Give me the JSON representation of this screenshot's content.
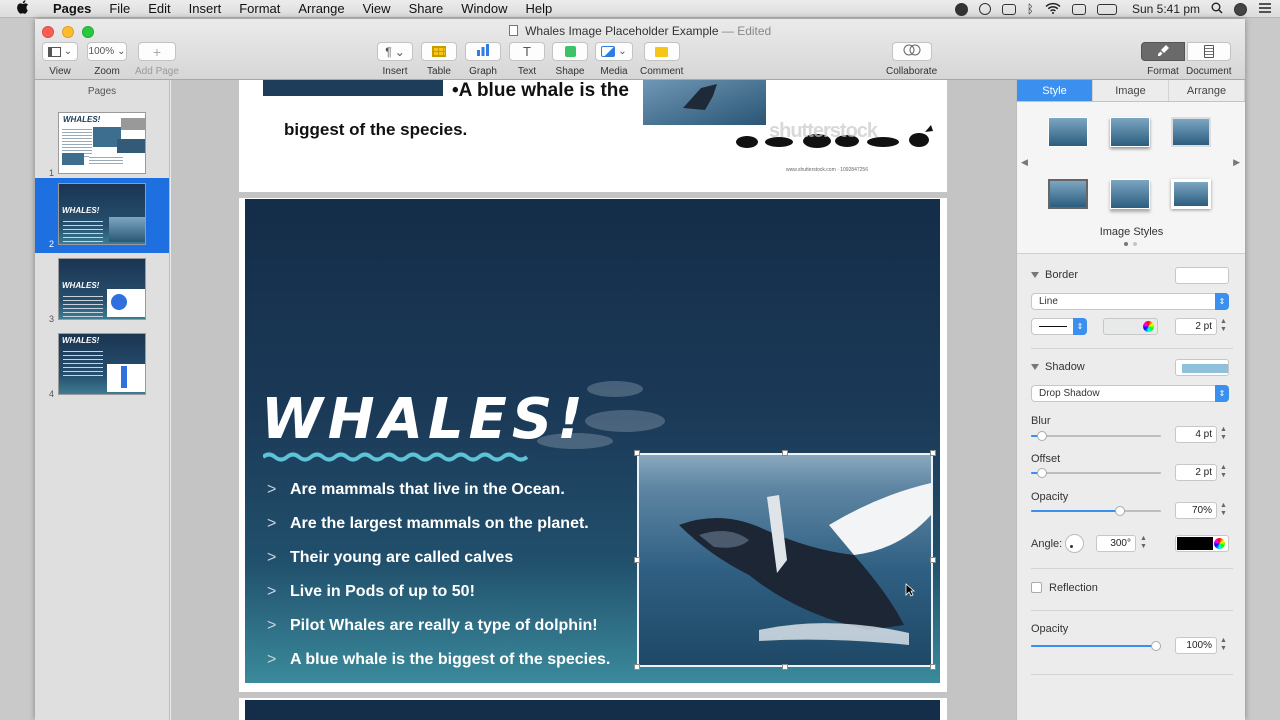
{
  "menubar": {
    "app": "Pages",
    "items": [
      "File",
      "Edit",
      "Insert",
      "Format",
      "Arrange",
      "View",
      "Share",
      "Window",
      "Help"
    ],
    "clock": "Sun 5:41 pm"
  },
  "window": {
    "filename": "Whales Image Placeholder Example",
    "status": "— Edited"
  },
  "toolbar": {
    "view": "View",
    "zoom": "Zoom",
    "zoom_value": "100%",
    "add_page": "Add Page",
    "insert": "Insert",
    "table": "Table",
    "graph": "Graph",
    "text": "Text",
    "shape": "Shape",
    "media": "Media",
    "comment": "Comment",
    "collaborate": "Collaborate",
    "format": "Format",
    "document": "Document"
  },
  "pages": {
    "header": "Pages",
    "items": [
      {
        "num": "1"
      },
      {
        "num": "2"
      },
      {
        "num": "3"
      },
      {
        "num": "4"
      }
    ],
    "thumb_title": "WHALES!"
  },
  "page1": {
    "bullet": "•A blue whale is the",
    "line2": "biggest of the species.",
    "watermark": "shutterstock",
    "credit": "www.shutterstock.com · 1092847256"
  },
  "slide": {
    "title": "WHALES!",
    "bullets": [
      "Are mammals that live in the Ocean.",
      "Are the largest mammals on the planet.",
      "Their young are called calves",
      "Live in Pods of up to 50!",
      "Pilot Whales are really a type of dolphin!",
      "A blue whale is the biggest of the species."
    ]
  },
  "inspector": {
    "tabs": [
      "Style",
      "Image",
      "Arrange"
    ],
    "image_styles_label": "Image Styles",
    "border": {
      "label": "Border",
      "type": "Line",
      "width": "2 pt"
    },
    "shadow": {
      "label": "Shadow",
      "type": "Drop Shadow",
      "blur_label": "Blur",
      "blur": "4 pt",
      "blur_level": 0.05,
      "offset_label": "Offset",
      "offset": "2 pt",
      "offset_level": 0.05,
      "opacity_label": "Opacity",
      "opacity": "70%",
      "opacity_level": 0.7,
      "angle_label": "Angle:",
      "angle": "300°",
      "color": "#000000"
    },
    "reflection": {
      "label": "Reflection"
    },
    "opacity": {
      "label": "Opacity",
      "value": "100%",
      "level": 1.0
    }
  }
}
